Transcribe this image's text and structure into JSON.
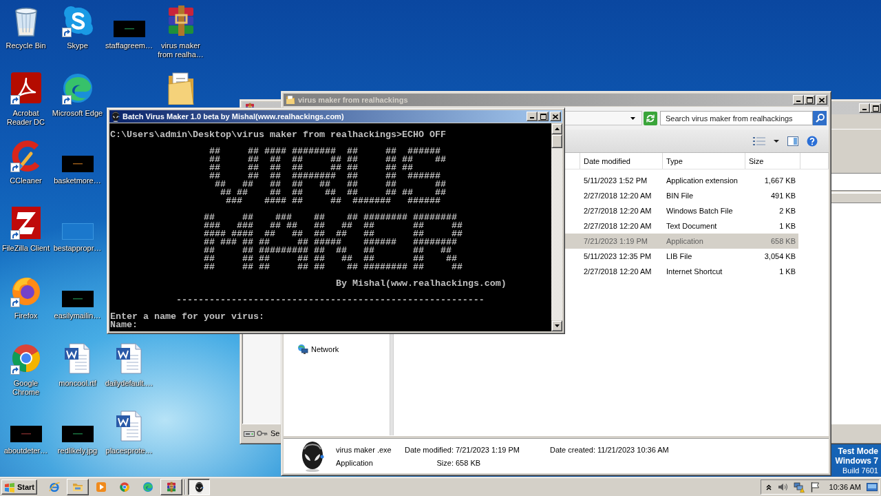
{
  "desktop": {
    "icons": [
      {
        "label": "Recycle Bin",
        "shortcut": false
      },
      {
        "label": "Acrobat Reader DC",
        "shortcut": true
      },
      {
        "label": "CCleaner",
        "shortcut": true
      },
      {
        "label": "FileZilla Client",
        "shortcut": true
      },
      {
        "label": "Firefox",
        "shortcut": true
      },
      {
        "label": "Google Chrome",
        "shortcut": true
      },
      {
        "label": "aboutdeter…",
        "shortcut": false
      },
      {
        "label": "Skype",
        "shortcut": true
      },
      {
        "label": "Microsoft Edge",
        "shortcut": true
      },
      {
        "label": "basketmore…",
        "shortcut": false
      },
      {
        "label": "bestappropr…",
        "shortcut": false
      },
      {
        "label": "easilymailin…",
        "shortcut": false
      },
      {
        "label": "moncool.rtf",
        "shortcut": false
      },
      {
        "label": "redlikely.jpg",
        "shortcut": false
      },
      {
        "label": "staffagreem…",
        "shortcut": false
      },
      {
        "label": "dailydefault.…",
        "shortcut": false
      },
      {
        "label": "placesprote…",
        "shortcut": false
      },
      {
        "label": "virus maker from realha…",
        "shortcut": false
      },
      {
        "shortcut": false
      }
    ],
    "notice": [
      "Test Mode",
      "Windows 7",
      "Build 7601"
    ]
  },
  "archiver_window": {
    "status": "Se"
  },
  "explorer": {
    "active": false,
    "title": "virus maker from realhackings",
    "search": {
      "placeholder": "Search virus maker from realhackings"
    },
    "columns": [
      "Date modified",
      "Type",
      "Size"
    ],
    "files": [
      {
        "date_modified": "5/11/2023 1:52 PM",
        "type": "Application extension",
        "size": "1,667 KB",
        "selected": false
      },
      {
        "date_modified": "2/27/2018 12:20 AM",
        "type": "BIN File",
        "size": "491 KB",
        "selected": false
      },
      {
        "date_modified": "2/27/2018 12:20 AM",
        "type": "Windows Batch File",
        "size": "2 KB",
        "selected": false
      },
      {
        "date_modified": "2/27/2018 12:20 AM",
        "type": "Text Document",
        "size": "1 KB",
        "selected": false
      },
      {
        "date_modified": "7/21/2023 1:19 PM",
        "type": "Application",
        "size": "658 KB",
        "selected": true
      },
      {
        "date_modified": "5/11/2023 12:35 PM",
        "type": "LIB File",
        "size": "3,054 KB",
        "selected": false
      },
      {
        "date_modified": "2/27/2018 12:20 AM",
        "type": "Internet Shortcut",
        "size": "1 KB",
        "selected": false
      }
    ],
    "nav": [
      {
        "label": "Network"
      }
    ],
    "details": {
      "name": "virus maker .exe",
      "type": "Application",
      "fields": [
        {
          "label": "Date modified:",
          "value": "7/21/2023 1:19 PM"
        },
        {
          "label": "Size:",
          "value": "658 KB"
        },
        {
          "label": "Date created:",
          "value": "11/21/2023 10:36 AM"
        }
      ]
    }
  },
  "console": {
    "active": true,
    "title": "Batch Virus Maker 1.0 beta by Mishal(www.realhackings.com)",
    "prompt": "C:\\Users\\admin\\Desktop\\virus maker from realhackings>ECHO OFF",
    "banner": [
      [
        "##     ## #### ########  ##     ##  ######",
        "##     ##  ##  ##     ## ##     ## ##    ##",
        "##     ##  ##  ##     ## ##     ## ##",
        "##     ##  ##  ########  ##     ##  ######",
        " ##   ##   ##  ##   ##   ##     ##       ##",
        "  ## ##    ##  ##    ##  ##     ## ##    ##",
        "   ###    #### ##     ##  #######   ######"
      ],
      [
        "##     ##    ###    ##    ## ######## ########",
        "###   ###   ## ##   ##   ##  ##       ##     ##",
        "#### ####  ##   ##  ##  ##   ##       ##     ##",
        "## ### ## ##     ## #####    ######   ########",
        "##     ## ######### ##  ##   ##       ##   ##",
        "##     ## ##     ## ##   ##  ##       ##    ##",
        "##     ## ##     ## ##    ## ######## ##     ##"
      ]
    ],
    "byline": "By Mishal(www.realhackings.com)",
    "rule": "--------------------------------------------------------",
    "question": "Enter a name for your virus:",
    "input_label": "Name:"
  },
  "taskbar": {
    "start": "Start",
    "buttons": [
      {
        "running": false,
        "selected": false
      },
      {
        "running": true,
        "selected": false
      },
      {
        "running": false,
        "selected": false
      },
      {
        "running": false,
        "selected": false
      },
      {
        "running": false,
        "selected": false
      },
      {
        "running": true,
        "selected": false
      },
      {
        "running": true,
        "selected": true
      }
    ],
    "clock": "10:36 AM"
  }
}
